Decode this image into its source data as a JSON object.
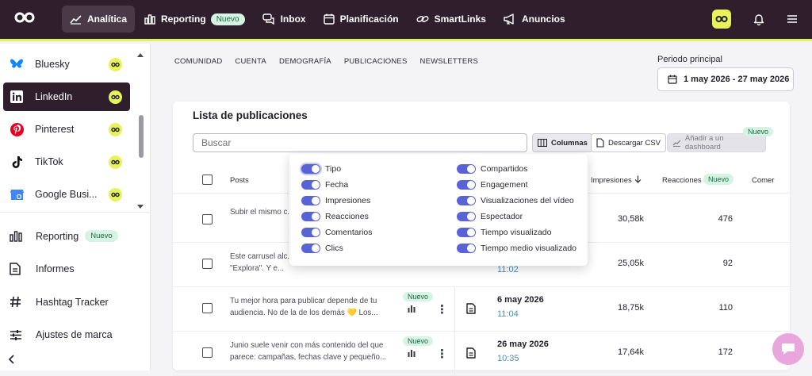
{
  "topnav": {
    "items": [
      {
        "label": "Analítica",
        "icon": "chart-line-icon",
        "active": true
      },
      {
        "label": "Reporting",
        "icon": "bar-chart-icon",
        "badge": "Nuevo"
      },
      {
        "label": "Inbox",
        "icon": "chat-bubbles-icon"
      },
      {
        "label": "Planificación",
        "icon": "calendar-icon"
      },
      {
        "label": "SmartLinks",
        "icon": "link-icon"
      },
      {
        "label": "Anuncios",
        "icon": "megaphone-icon"
      }
    ]
  },
  "sidebar": {
    "networks": [
      {
        "label": "Bluesky",
        "icon": "bluesky-icon"
      },
      {
        "label": "LinkedIn",
        "icon": "linkedin-icon",
        "active": true
      },
      {
        "label": "Pinterest",
        "icon": "pinterest-icon"
      },
      {
        "label": "TikTok",
        "icon": "tiktok-icon"
      },
      {
        "label": "Google Busi...",
        "icon": "google-business-icon"
      }
    ],
    "tools": [
      {
        "label": "Reporting",
        "icon": "bar-chart-icon",
        "badge": "Nuevo"
      },
      {
        "label": "Informes",
        "icon": "document-icon"
      },
      {
        "label": "Hashtag Tracker",
        "icon": "hashtag-icon"
      },
      {
        "label": "Ajustes de marca",
        "icon": "sliders-icon"
      }
    ]
  },
  "subtabs": [
    "COMUNIDAD",
    "CUENTA",
    "DEMOGRAFÍA",
    "PUBLICACIONES",
    "NEWSLETTERS"
  ],
  "period": {
    "label": "Periodo principal",
    "value": "1 may 2026 - 27 may 2026"
  },
  "card": {
    "title": "Lista de publicaciones",
    "search_placeholder": "Buscar",
    "btn_columns": "Columnas",
    "btn_csv": "Descargar CSV",
    "btn_dashboard": "Añadir a un dashboard",
    "dashboard_badge": "Nuevo"
  },
  "table": {
    "headers": {
      "posts": "Posts",
      "impressions": "Impresiones",
      "reactions": "Reacciones",
      "reactions_badge": "Nuevo",
      "comments": "Comer"
    },
    "rows": [
      {
        "text": "Subir el mismo c... Instagram y obte...",
        "date": "",
        "time": "",
        "impressions": "30,58k",
        "reactions": "476",
        "badge": ""
      },
      {
        "text": "Este carrusel alc... impresiones en la sección de \"Explora\". Y e...",
        "date": "",
        "time": "11:02",
        "impressions": "25,05k",
        "reactions": "92",
        "badge": ""
      },
      {
        "text": "Tu mejor hora para publicar depende de tu audiencia. No de la de los demás 💛 Los...",
        "date": "6 may 2026",
        "time": "11:04",
        "impressions": "18,75k",
        "reactions": "110",
        "badge": "Nuevo"
      },
      {
        "text": "Junio suele venir con más contenido del que parece: campañas, fechas clave y pequeño...",
        "date": "26 may 2026",
        "time": "10:35",
        "impressions": "17,64k",
        "reactions": "172",
        "badge": "Nuevo"
      }
    ]
  },
  "columns_menu": {
    "left": [
      "Tipo",
      "Fecha",
      "Impresiones",
      "Reacciones",
      "Comentarios",
      "Clics"
    ],
    "right": [
      "Compartidos",
      "Engagement",
      "Visualizaciones del vídeo",
      "Espectador",
      "Tiempo visualizado",
      "Tiempo medio visualizado"
    ]
  },
  "colors": {
    "topbar": "#2f1f2d",
    "accent_yellow": "#e8f25a",
    "toggle": "#5864d6",
    "badge_bg": "#d6f3e3"
  }
}
